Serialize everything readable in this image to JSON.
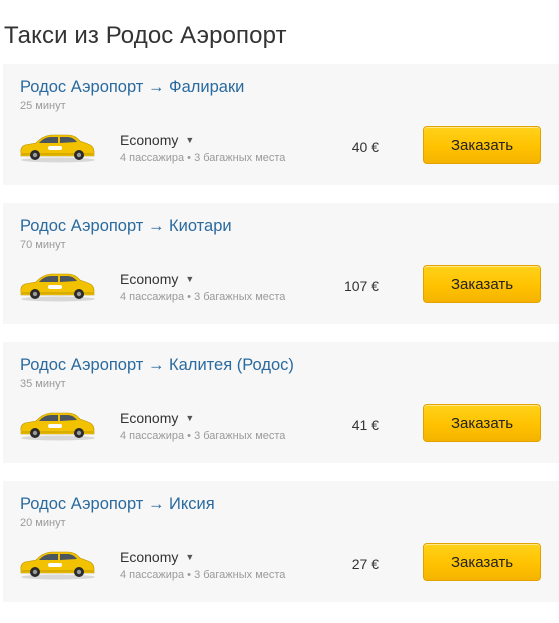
{
  "page": {
    "title": "Такси из Родос Аэропорт"
  },
  "routes": [
    {
      "title": "Родос Аэропорт → Фалираки",
      "duration": "25 минут",
      "car_class": "Economy",
      "capacity": "4 пассажира • 3 багажных места",
      "price": "40 €",
      "order_label": "Заказать"
    },
    {
      "title": "Родос Аэропорт → Киотари",
      "duration": "70 минут",
      "car_class": "Economy",
      "capacity": "4 пассажира • 3 багажных места",
      "price": "107 €",
      "order_label": "Заказать"
    },
    {
      "title": "Родос Аэропорт → Калитея (Родос)",
      "duration": "35 минут",
      "car_class": "Economy",
      "capacity": "4 пассажира • 3 багажных места",
      "price": "41 €",
      "order_label": "Заказать"
    },
    {
      "title": "Родос Аэропорт → Иксия",
      "duration": "20 минут",
      "car_class": "Economy",
      "capacity": "4 пассажира • 3 багажных места",
      "price": "27 €",
      "order_label": "Заказать"
    }
  ],
  "icons": {
    "car": "yellow-taxi-car-icon",
    "dropdown": "caret-down-icon"
  },
  "colors": {
    "route_link": "#2a6a9e",
    "card_background": "#f7f7f7",
    "button_yellow": "#ffc200",
    "taxi_yellow": "#f2c200"
  }
}
